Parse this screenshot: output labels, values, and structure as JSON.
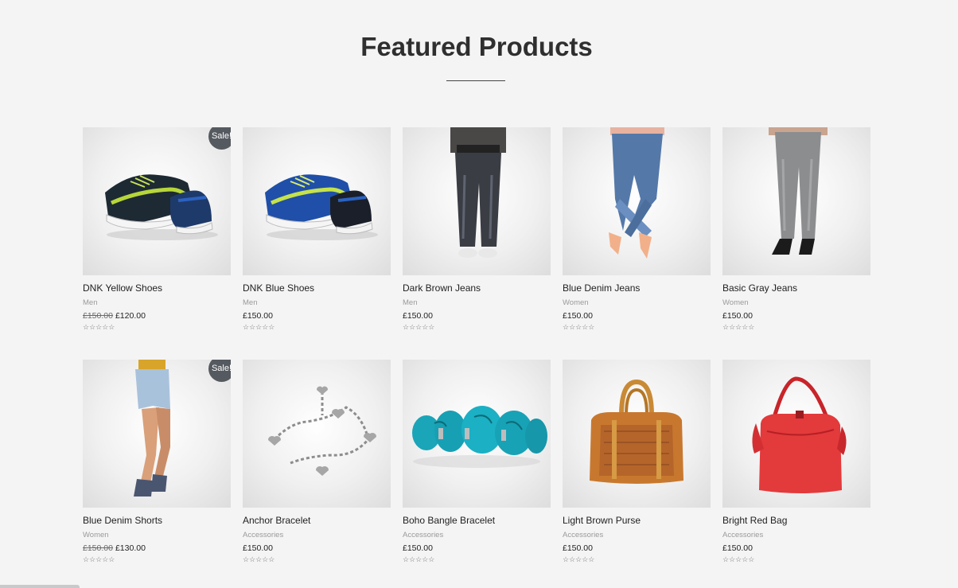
{
  "section": {
    "title": "Featured Products"
  },
  "badges": {
    "sale": "Sale!"
  },
  "rating_glyph": "☆☆☆☆☆",
  "products": [
    {
      "name": "DNK Yellow Shoes",
      "category": "Men",
      "old_price": "£150.00",
      "price": "£120.00",
      "icon": "sneakers-image",
      "on_sale": true
    },
    {
      "name": "DNK Blue Shoes",
      "category": "Men",
      "price": "£150.00",
      "icon": "sneakers-image"
    },
    {
      "name": "Dark Brown Jeans",
      "category": "Men",
      "price": "£150.00",
      "icon": "jeans-model-image"
    },
    {
      "name": "Blue Denim Jeans",
      "category": "Women",
      "price": "£150.00",
      "icon": "jeans-model-image"
    },
    {
      "name": "Basic Gray Jeans",
      "category": "Women",
      "price": "£150.00",
      "icon": "jeans-model-image"
    },
    {
      "name": "Blue Denim Shorts",
      "category": "Women",
      "old_price": "£150.00",
      "price": "£130.00",
      "icon": "shorts-model-image",
      "on_sale": true
    },
    {
      "name": "Anchor Bracelet",
      "category": "Accessories",
      "price": "£150.00",
      "icon": "bracelet-image"
    },
    {
      "name": "Boho Bangle Bracelet",
      "category": "Accessories",
      "price": "£150.00",
      "icon": "bangle-image"
    },
    {
      "name": "Light Brown Purse",
      "category": "Accessories",
      "price": "£150.00",
      "icon": "purse-image"
    },
    {
      "name": "Bright Red Bag",
      "category": "Accessories",
      "price": "£150.00",
      "icon": "bag-image"
    }
  ],
  "colors": {
    "background": "#f4f4f5",
    "sale_badge": "#555a60",
    "text": "#1f1f1f",
    "muted": "#9a9a9a"
  }
}
